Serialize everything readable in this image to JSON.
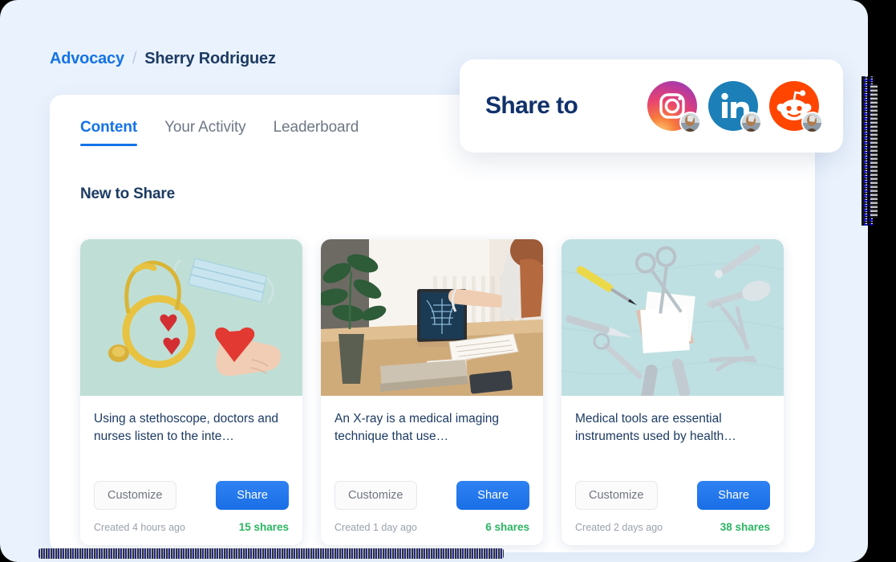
{
  "breadcrumb": {
    "root": "Advocacy",
    "separator": "/",
    "leaf": "Sherry Rodriguez"
  },
  "tabs": [
    {
      "label": "Content",
      "active": true
    },
    {
      "label": "Your Activity",
      "active": false
    },
    {
      "label": "Leaderboard",
      "active": false
    }
  ],
  "section": {
    "title": "New to Share"
  },
  "share_to": {
    "label": "Share to",
    "networks": [
      {
        "name": "Instagram",
        "icon": "instagram-icon",
        "color": "#E8436F"
      },
      {
        "name": "LinkedIn",
        "icon": "linkedin-icon",
        "color": "#1C7FB8"
      },
      {
        "name": "Reddit",
        "icon": "reddit-icon",
        "color": "#FF4500"
      }
    ]
  },
  "cards": [
    {
      "title": "Using a stethoscope, doctors and nurses listen to the inte…",
      "customize_label": "Customize",
      "share_label": "Share",
      "created": "Created 4 hours ago",
      "shares": "15 shares",
      "image_alt": "Yellow stethoscope, surgical mask and red hearts on mint background"
    },
    {
      "title": "An X-ray is a medical imaging technique that use…",
      "customize_label": "Customize",
      "share_label": "Share",
      "created": "Created 1 day ago",
      "shares": "6 shares",
      "image_alt": "Doctor at wooden desk reviewing an X-ray on a tablet"
    },
    {
      "title": "Medical tools are essential instruments used by health…",
      "customize_label": "Customize",
      "share_label": "Share",
      "created": "Created 2 days ago",
      "shares": "38 shares",
      "image_alt": "Surgical instruments arranged on light blue cloth"
    }
  ],
  "colors": {
    "page_background": "#EAF2FD",
    "accent_blue": "#1373E6",
    "heading_navy": "#1D3B63",
    "share_green": "#2BB563",
    "muted_gray": "#9AA1AB"
  }
}
